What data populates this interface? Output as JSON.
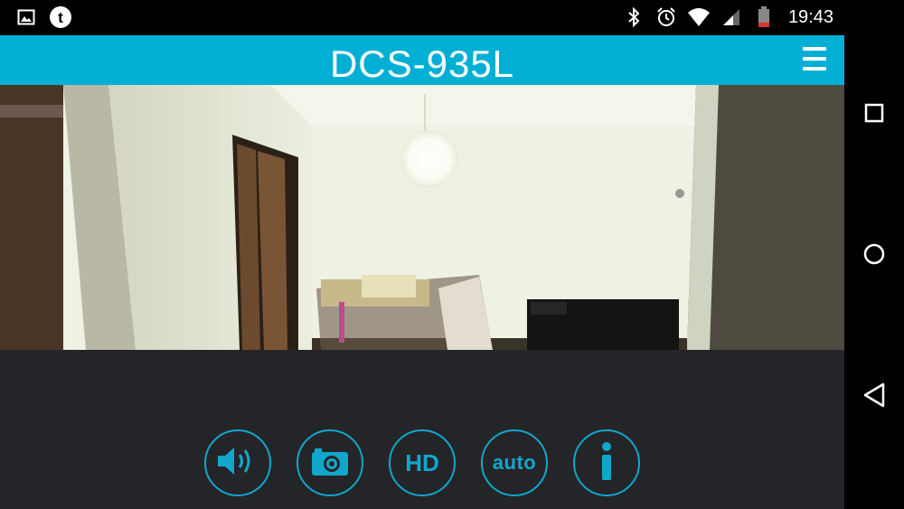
{
  "status_bar": {
    "time": "19:43",
    "icons": [
      "gallery-icon",
      "tumblr-icon",
      "bluetooth-icon",
      "alarm-icon",
      "wifi-icon",
      "cell-signal-icon",
      "battery-icon"
    ]
  },
  "app": {
    "title": "DCS-935L",
    "header_color": "#00afd3",
    "accent_color": "#11a7cc"
  },
  "controls": {
    "hd_label": "HD",
    "auto_label": "auto"
  },
  "nav": [
    "recents-icon",
    "home-icon",
    "back-icon"
  ]
}
